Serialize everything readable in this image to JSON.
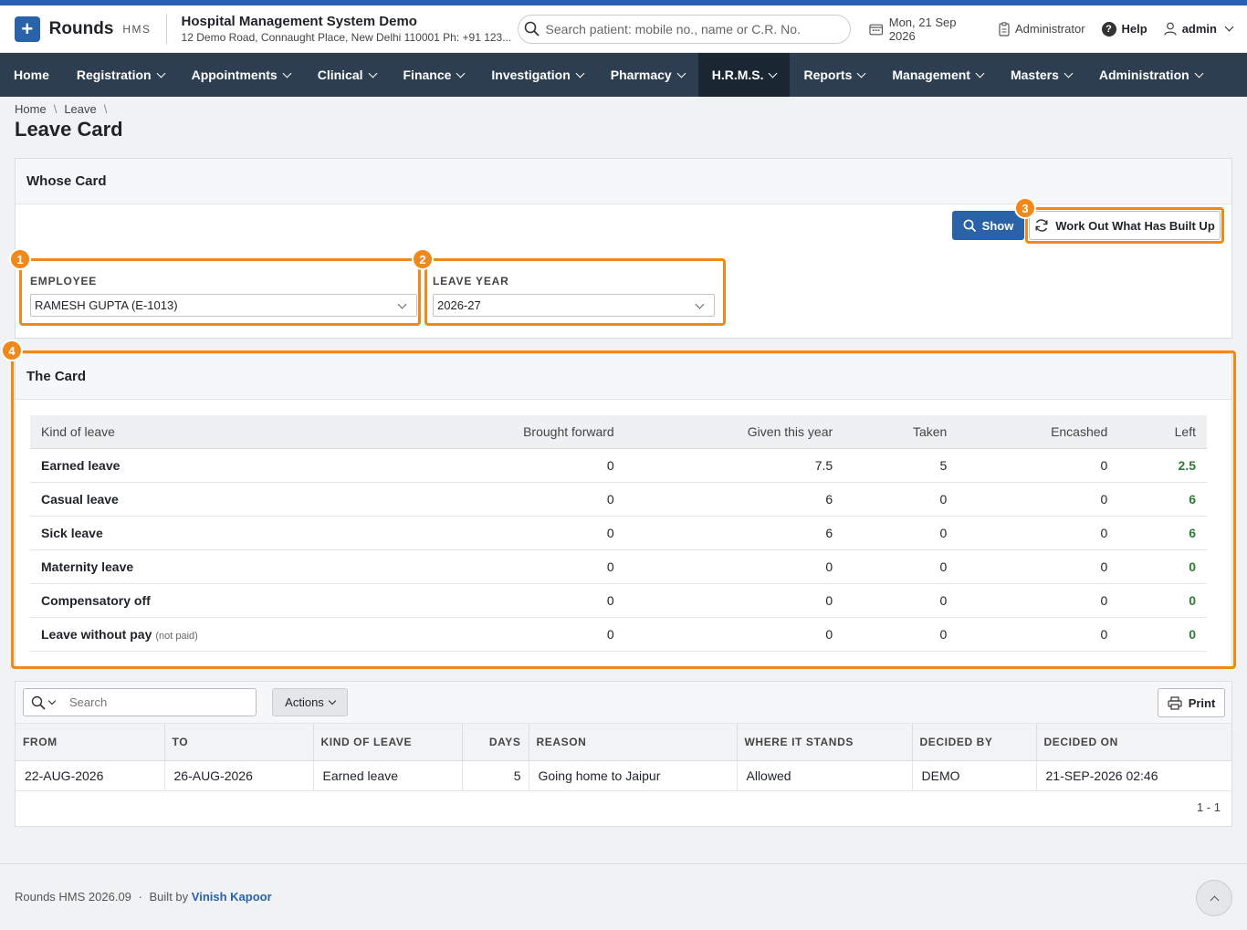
{
  "app": {
    "brand": "Rounds",
    "brand_sub": "HMS",
    "org_name": "Hospital Management System Demo",
    "org_address": "12 Demo Road, Connaught Place, New Delhi 110001 Ph: +91 123..."
  },
  "header": {
    "search_placeholder": "Search patient: mobile no., name or C.R. No.",
    "date": "Mon, 21 Sep 2026",
    "role": "Administrator",
    "help": "Help",
    "user": "admin"
  },
  "nav": [
    {
      "label": "Home",
      "dropdown": false
    },
    {
      "label": "Registration",
      "dropdown": true
    },
    {
      "label": "Appointments",
      "dropdown": true
    },
    {
      "label": "Clinical",
      "dropdown": true
    },
    {
      "label": "Finance",
      "dropdown": true
    },
    {
      "label": "Investigation",
      "dropdown": true
    },
    {
      "label": "Pharmacy",
      "dropdown": true
    },
    {
      "label": "H.R.M.S.",
      "dropdown": true,
      "active": true
    },
    {
      "label": "Reports",
      "dropdown": true
    },
    {
      "label": "Management",
      "dropdown": true
    },
    {
      "label": "Masters",
      "dropdown": true
    },
    {
      "label": "Administration",
      "dropdown": true
    }
  ],
  "breadcrumb": [
    "Home",
    "Leave"
  ],
  "page_title": "Leave Card",
  "whose_card": {
    "title": "Whose Card",
    "show_button": "Show",
    "work_out_button": "Work Out What Has Built Up",
    "employee_label": "EMPLOYEE",
    "employee_value": "RAMESH GUPTA (E-1013)",
    "year_label": "LEAVE YEAR",
    "year_value": "2026-27"
  },
  "badges": [
    "1",
    "2",
    "3",
    "4"
  ],
  "the_card": {
    "title": "The Card",
    "columns": [
      "Kind of leave",
      "Brought forward",
      "Given this year",
      "Taken",
      "Encashed",
      "Left"
    ],
    "rows": [
      {
        "kind": "Earned leave",
        "note": "",
        "bf": "0",
        "given": "7.5",
        "taken": "5",
        "encashed": "0",
        "left": "2.5"
      },
      {
        "kind": "Casual leave",
        "note": "",
        "bf": "0",
        "given": "6",
        "taken": "0",
        "encashed": "0",
        "left": "6"
      },
      {
        "kind": "Sick leave",
        "note": "",
        "bf": "0",
        "given": "6",
        "taken": "0",
        "encashed": "0",
        "left": "6"
      },
      {
        "kind": "Maternity leave",
        "note": "",
        "bf": "0",
        "given": "0",
        "taken": "0",
        "encashed": "0",
        "left": "0"
      },
      {
        "kind": "Compensatory off",
        "note": "",
        "bf": "0",
        "given": "0",
        "taken": "0",
        "encashed": "0",
        "left": "0"
      },
      {
        "kind": "Leave without pay",
        "note": "(not paid)",
        "bf": "0",
        "given": "0",
        "taken": "0",
        "encashed": "0",
        "left": "0"
      }
    ],
    "left_color": "#2e7d32"
  },
  "history": {
    "search_placeholder": "Search",
    "actions_label": "Actions",
    "print_label": "Print",
    "columns": [
      "FROM",
      "TO",
      "KIND OF LEAVE",
      "DAYS",
      "REASON",
      "WHERE IT STANDS",
      "DECIDED BY",
      "DECIDED ON"
    ],
    "rows": [
      {
        "from": "22-AUG-2026",
        "to": "26-AUG-2026",
        "kind": "Earned leave",
        "days": "5",
        "reason": "Going home to Jaipur",
        "status": "Allowed",
        "decided_by": "DEMO",
        "decided_on": "21-SEP-2026 02:46"
      }
    ],
    "pagination": "1 - 1"
  },
  "footer": {
    "version": "Rounds HMS 2026.09",
    "separator": "·",
    "built_by_prefix": "Built by",
    "author": "Vinish Kapoor"
  },
  "colors": {
    "accent": "#2a62a9",
    "nav_bg": "#2c3e4f",
    "highlight": "#f0891a"
  }
}
